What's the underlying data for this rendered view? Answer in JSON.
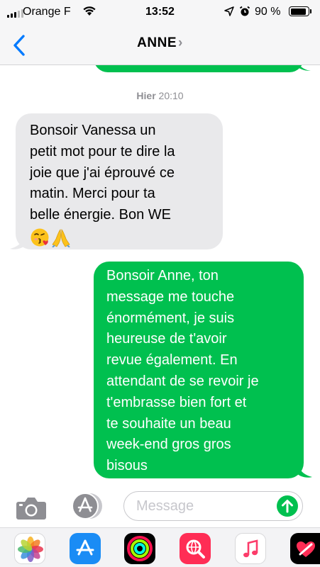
{
  "status_bar": {
    "carrier": "Orange F",
    "time": "13:52",
    "battery": "90 %",
    "battery_level": 0.9,
    "signal_bars_active": 3,
    "signal_bars_total": 5
  },
  "nav": {
    "contact_name": "ANNE",
    "contact_chevron": "›",
    "back_icon": "chevron-left-icon"
  },
  "conversation": {
    "timestamp_day": "Hier",
    "timestamp_time": "20:10",
    "messages": [
      {
        "direction": "incoming",
        "lines": [
          "Bonsoir Vanessa un",
          "petit mot pour te dire la",
          "joie que j'ai éprouvé ce",
          "matin. Merci pour ta",
          "belle énergie. Bon WE"
        ],
        "emojis": [
          "😘",
          "🙏"
        ]
      },
      {
        "direction": "outgoing",
        "lines": [
          "Bonsoir Anne, ton",
          "message me touche",
          "énormément, je suis",
          "heureuse de t'avoir",
          "revue également. En",
          "attendant de se revoir je",
          "t'embrasse bien fort et",
          "te souhaite un beau",
          "week-end gros gros",
          "bisous"
        ]
      }
    ]
  },
  "input_bar": {
    "placeholder": "Message"
  },
  "colors": {
    "sent_bubble": "#00c04f",
    "received_bubble": "#e9e9eb",
    "accent_blue": "#007aff",
    "timestamp_gray": "#8e8e93"
  },
  "app_drawer": {
    "apps": [
      "photos-icon",
      "app-store-icon",
      "activity-icon",
      "search-images-icon",
      "music-icon",
      "digital-touch-icon"
    ]
  }
}
